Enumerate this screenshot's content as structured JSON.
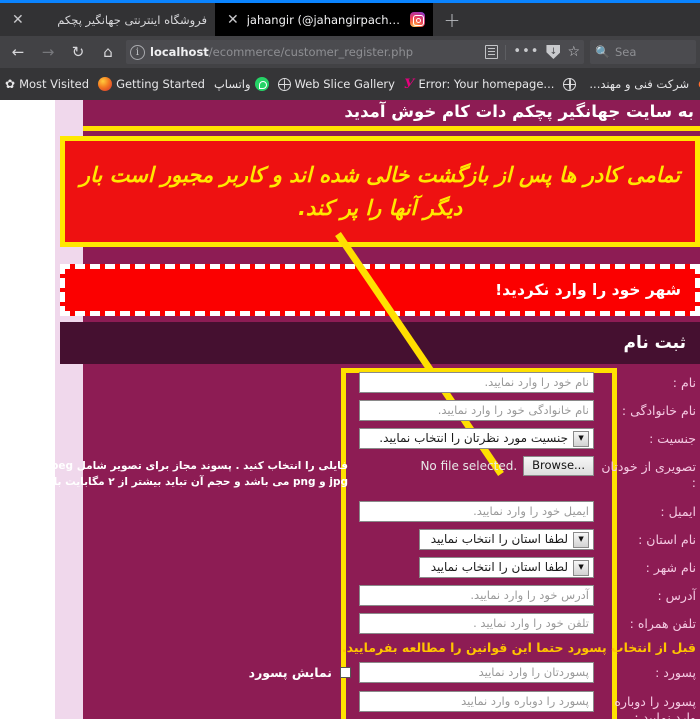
{
  "browser": {
    "tabs": [
      {
        "title": "فروشگاه اینترنتی جهانگیر پچکم",
        "active": false,
        "icon": "none",
        "close_label": "✕"
      },
      {
        "title": "jahangir (@jahangirpachkam) • Ins",
        "active": true,
        "icon": "instagram-icon",
        "close_label": "✕"
      }
    ],
    "new_tab_label": "+",
    "nav": {
      "back_label": "←",
      "forward_label": "→",
      "reload_label": "↻",
      "home_label": "⌂"
    },
    "url": {
      "info_label": "i",
      "host": "localhost",
      "path": "/ecommerce/customer_register.php"
    },
    "search": {
      "placeholder": "Sea",
      "icon": "search-icon"
    },
    "bookmarks": [
      {
        "label": "Most Visited",
        "icon": "star-outline-icon"
      },
      {
        "label": "Getting Started",
        "icon": "firefox-icon"
      },
      {
        "label": "واتساپ",
        "icon": "whatsapp-icon"
      },
      {
        "label": "Web Slice Gallery",
        "icon": "globe-icon"
      },
      {
        "label": "Error: Your homepage...",
        "icon": "yandex-icon"
      },
      {
        "label": "",
        "icon": "globe-icon"
      },
      {
        "label": "شرکت فنی و مهند...",
        "icon": "none"
      },
      {
        "label": "",
        "icon": "cpanel-icon"
      }
    ]
  },
  "site": {
    "welcome": "به سایت جهانگیر پچکم دات کام خوش آمدید",
    "callout": "تمامی کادر ها پس از بازگشت خالی شده اند و کاربر مجبور است بار دیگر آنها را پر کند.",
    "alert": "شهر خود را وارد نکردید!",
    "section_title": "ثبت نام",
    "form": {
      "rows": [
        {
          "label": "نام :",
          "type": "text",
          "placeholder": "نام خود را وارد نمایید."
        },
        {
          "label": "نام خانوادگی :",
          "type": "text",
          "placeholder": "نام خانوادگی خود را وارد نمایید."
        },
        {
          "label": "جنسیت :",
          "type": "select",
          "value": "جنسیت مورد نظرتان را انتخاب نمایید."
        },
        {
          "label": "تصویری از خودتان :",
          "type": "file",
          "browse_label": "Browse...",
          "no_file_text": "No file selected."
        },
        {
          "label": "ایمیل :",
          "type": "text",
          "placeholder": "ایمیل خود را وارد نمایید."
        },
        {
          "label": "نام استان :",
          "type": "select",
          "value": "لطفا استان را انتخاب نمایید"
        },
        {
          "label": "نام شهر :",
          "type": "select",
          "value": "لطفا استان را انتخاب نمایید"
        },
        {
          "label": "آدرس :",
          "type": "text",
          "placeholder": "آدرس خود را وارد نمایید."
        },
        {
          "label": "تلفن همراه :",
          "type": "text",
          "placeholder": "تلفن خود را وارد نمایید ."
        },
        {
          "label": "قبل از انتخاب پسورد",
          "type": "notice",
          "value": "قبل از انتخاب پسورد حتما این قوانین را مطالعه بفرمایید."
        },
        {
          "label": "پسورد :",
          "type": "password",
          "placeholder": "پسوردتان را وارد نمایید",
          "checkbox_label": "نمایش پسورد"
        },
        {
          "label": "پسورد را دوباره وارد نمایید :",
          "type": "password",
          "placeholder": "پسورد را دوباره وارد نمایید"
        }
      ],
      "file_hint_line1": "فایلی را انتخاب کنید . پسوند مجاز برای تصویر شامل jpeg و",
      "file_hint_line2": "jpg و png می باشد و حجم آن تباید بیشتر از ۲ مگابایت باشد"
    }
  },
  "colors": {
    "site_bg": "#8d1c54",
    "callout_bg": "#ee1111",
    "callout_border": "#ffe800",
    "alert_bg": "#fb0000",
    "section_bg": "#451030",
    "highlight": "#ffe000",
    "notice_text": "#ffc400",
    "label_text": "#f4c9e2"
  }
}
